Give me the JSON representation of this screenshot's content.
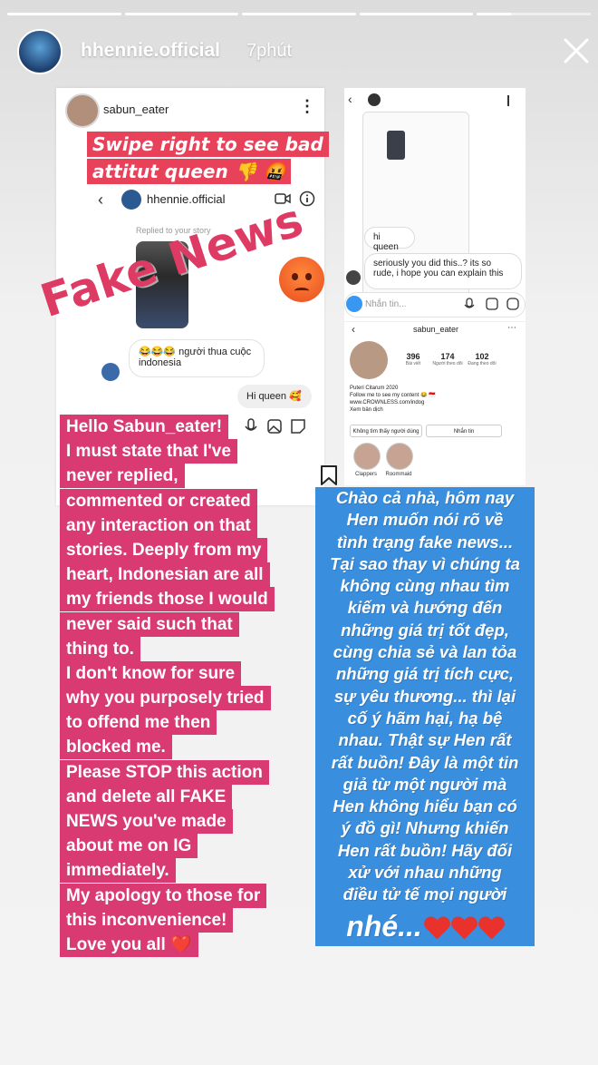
{
  "header": {
    "username": "hhennie.official",
    "time": "7phút",
    "progress_segments": [
      1,
      1,
      1,
      1,
      0.3
    ]
  },
  "left_screenshot": {
    "username": "sabun_eater",
    "banner_line1": "Swipe right to see bad",
    "banner_line2": "attitut queen 👎 🤬",
    "dm_username": "hhennie.official",
    "replied_label": "Replied to your story",
    "reply_message": "😂😂😂 người thua cuộc indonesia",
    "sent_message": "Hi queen 🥰",
    "overlay_text": "Fake News"
  },
  "right_screenshot": {
    "message1": "hi queen",
    "message2": "seriously you did this..? its so rude, i hope you can explain this",
    "message_placeholder": "Nhắn tin...",
    "profile_username": "sabun_eater",
    "posts_count": "396",
    "posts_label": "Bài viết",
    "followers_count": "174",
    "followers_label": "Người theo dõi",
    "following_count": "102",
    "following_label": "Đang theo dõi",
    "bio_name": "Puteri Citarum 2020",
    "bio_line1": "Follow me to see my content 😂 🇮🇩",
    "bio_link": "www.CROWNLESS.com/indog",
    "bio_translate": "Xem bản dịch",
    "button_no_user": "Không tìm thấy người dùng",
    "button_message": "Nhắn tin",
    "highlight1": "Clappers",
    "highlight2": "Roommaid"
  },
  "english_statement": [
    "Hello Sabun_eater!",
    "I must state that I've",
    "never replied,",
    "commented or created",
    "any interaction on that",
    "stories. Deeply from my",
    "heart, Indonesian are all",
    "my friends those I would",
    "never said such that",
    "thing to.",
    "I don't know for sure",
    "why you purposely tried",
    "to offend me then",
    "blocked me.",
    "Please STOP this action",
    "and delete all FAKE",
    "NEWS you've made",
    "about me on IG",
    "immediately.",
    "My apology to those for",
    "this inconvenience!",
    "Love you all ❤️"
  ],
  "vietnamese_statement": [
    "Chào cả nhà, hôm nay",
    "Hen muốn nói rõ về",
    "tình trạng fake news...",
    "Tại sao thay vì chúng ta",
    "không cùng nhau tìm",
    "kiếm và hướng đến",
    "những giá trị tốt đẹp,",
    "cùng chia sẻ và lan tỏa",
    "những giá trị tích cực,",
    "sự yêu thương... thì lại",
    "cố ý hãm hại, hạ bệ",
    "nhau. Thật sự Hen rất",
    "rất buồn! Đây là một tin",
    "giả từ một người mà",
    "Hen không hiểu bạn có",
    "ý đồ gì! Nhưng khiến",
    "Hen rất buồn! Hãy đối",
    "xử với nhau những",
    "điều tử tế mọi người"
  ],
  "vietnamese_closing": "nhé...",
  "colors": {
    "pink_highlight": "#d93a72",
    "blue_highlight": "#3a8ede",
    "fake_news_text": "#dd3a64"
  }
}
